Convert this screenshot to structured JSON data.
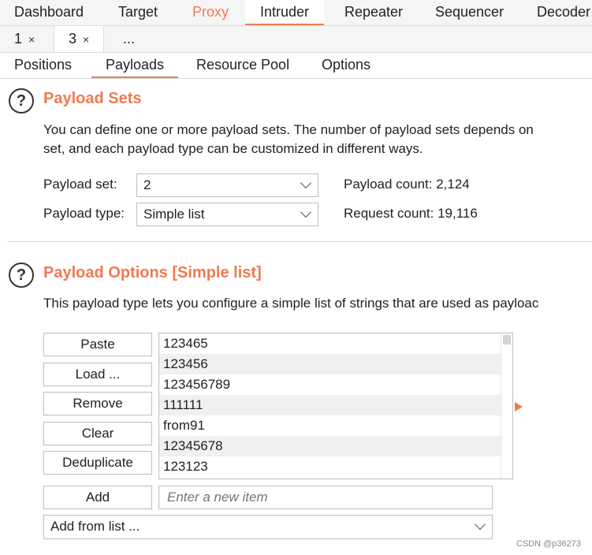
{
  "top_tabs": {
    "dashboard": "Dashboard",
    "target": "Target",
    "proxy": "Proxy",
    "intruder": "Intruder",
    "repeater": "Repeater",
    "sequencer": "Sequencer",
    "decoder": "Decoder"
  },
  "attack_tabs": {
    "tab1": "1",
    "tab3": "3",
    "more": "...",
    "close_symbol": "×"
  },
  "intruder_tabs": {
    "positions": "Positions",
    "payloads": "Payloads",
    "resource_pool": "Resource Pool",
    "options": "Options"
  },
  "payload_sets": {
    "help_symbol": "?",
    "title": "Payload Sets",
    "desc_line1": "You can define one or more payload sets. The number of payload sets depends on",
    "desc_line2": "set, and each payload type can be customized in different ways.",
    "set_label": "Payload set:",
    "set_value": "2",
    "type_label": "Payload type:",
    "type_value": "Simple list",
    "payload_count": "Payload count: 2,124",
    "request_count": "Request count: 19,116"
  },
  "payload_options": {
    "help_symbol": "?",
    "title": "Payload Options [Simple list]",
    "desc": "This payload type lets you configure a simple list of strings that are used as payloac",
    "buttons": {
      "paste": "Paste",
      "load": "Load ...",
      "remove": "Remove",
      "clear": "Clear",
      "deduplicate": "Deduplicate",
      "add": "Add"
    },
    "items": [
      "123465",
      "123456",
      "123456789",
      "111111",
      "from91",
      "12345678",
      "123123"
    ],
    "new_item_placeholder": "Enter a new item",
    "add_from_list": "Add from list ..."
  },
  "accent_color": "#f07a52",
  "watermark": "CSDN @p36273"
}
